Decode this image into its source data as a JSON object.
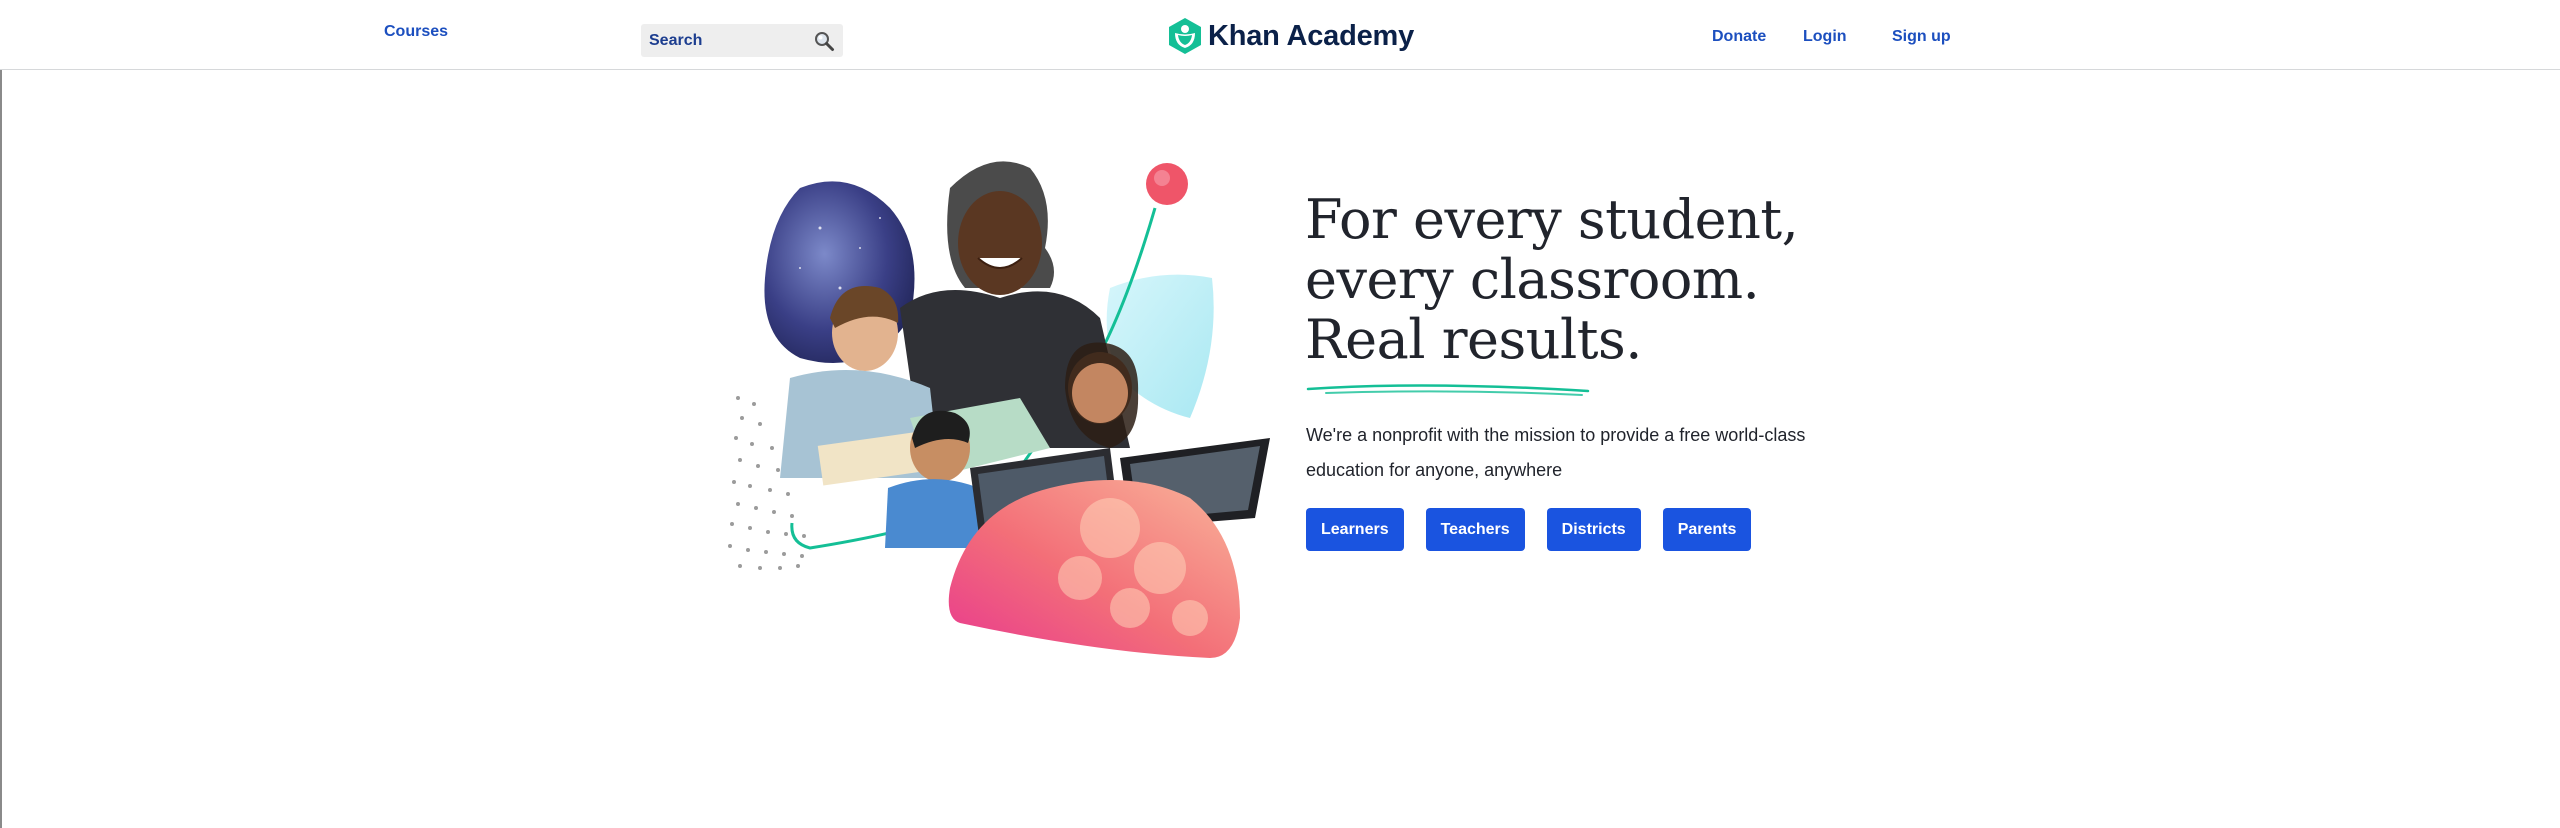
{
  "header": {
    "courses_label": "Courses",
    "search_placeholder": "Search",
    "logo_text": "Khan Academy",
    "donate_label": "Donate",
    "login_label": "Login",
    "signup_label": "Sign up"
  },
  "hero": {
    "headline_lines": [
      "For every student,",
      "every classroom.",
      "Real results."
    ],
    "mission_line1": "We're a nonprofit with the mission to provide a free world-class",
    "mission_line2": "education for anyone, anywhere",
    "buttons": [
      "Learners",
      "Teachers",
      "Districts",
      "Parents"
    ]
  },
  "colors": {
    "brand_green": "#14bf96",
    "link_blue": "#1c4fbf",
    "button_blue": "#1a54e0",
    "text_dark": "#21242c"
  },
  "icons": [
    "search-icon",
    "khan-academy-logo-icon"
  ]
}
